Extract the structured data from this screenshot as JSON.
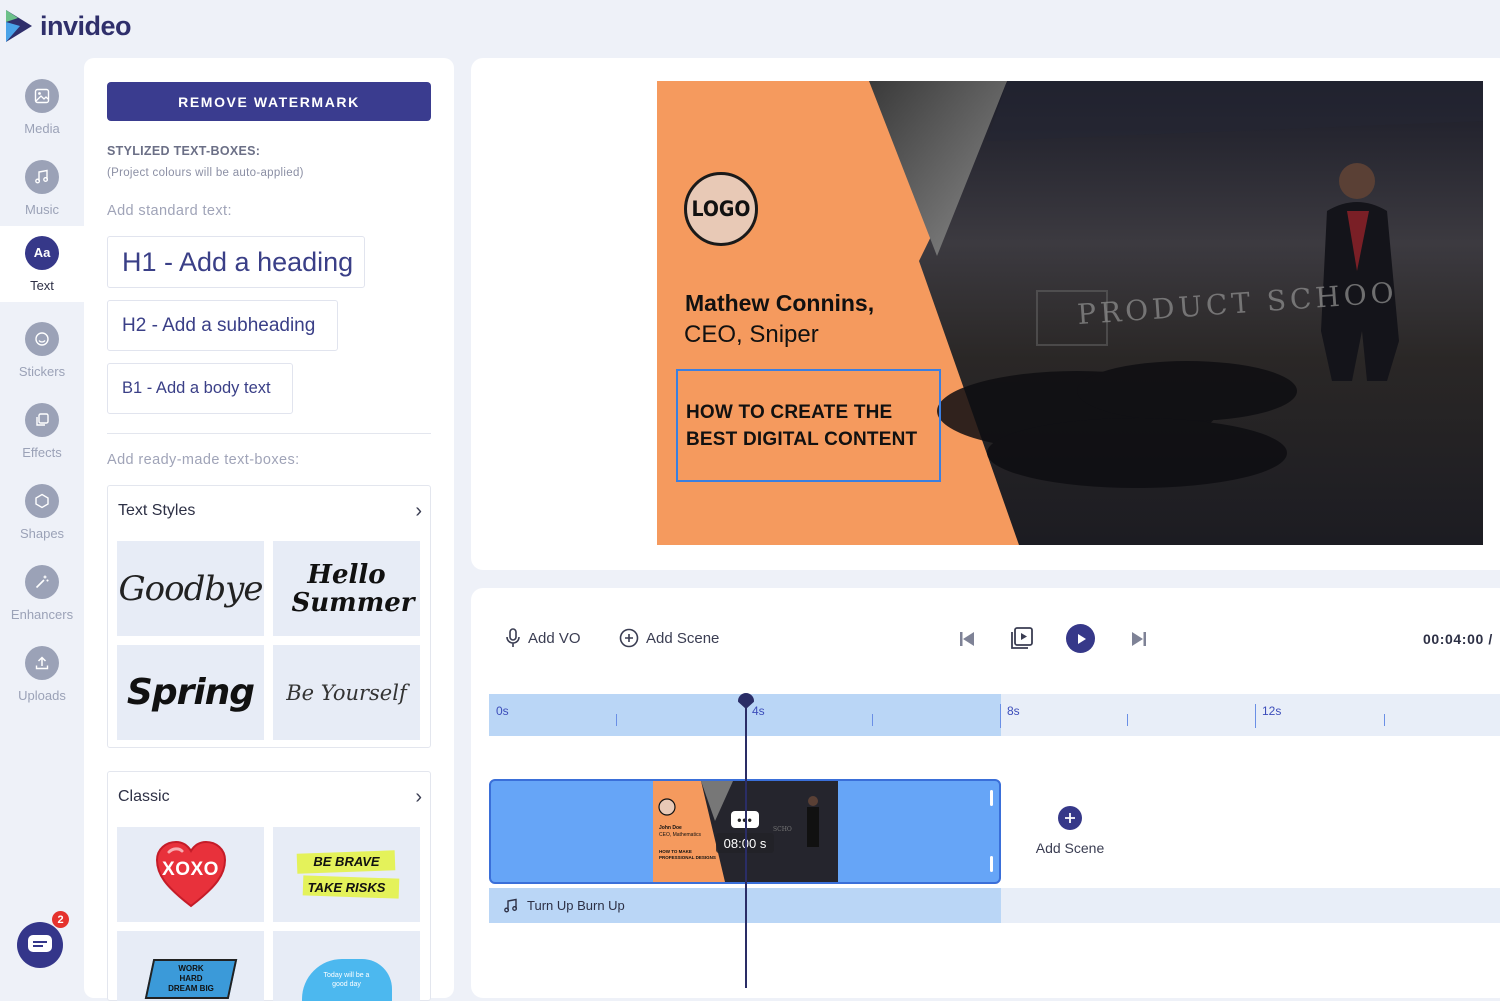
{
  "app": {
    "brand": "invideo",
    "colors": {
      "accent": "#3a3c8f",
      "orange": "#f59a5e",
      "timeline_blue": "#66a5f7",
      "badge_red": "#e5322d"
    }
  },
  "sidebar": {
    "items": [
      {
        "label": "Media",
        "icon": "image-icon"
      },
      {
        "label": "Music",
        "icon": "music-note-icon"
      },
      {
        "label": "Text",
        "icon_text": "Aa",
        "active": true
      },
      {
        "label": "Stickers",
        "icon": "smiley-icon"
      },
      {
        "label": "Effects",
        "icon": "layers-icon"
      },
      {
        "label": "Shapes",
        "icon": "hexagon-icon"
      },
      {
        "label": "Enhancers",
        "icon": "magic-wand-icon"
      },
      {
        "label": "Uploads",
        "icon": "upload-icon"
      }
    ],
    "chat_badge": "2"
  },
  "panel": {
    "remove_watermark": "REMOVE WATERMARK",
    "stylized_heading": "STYLIZED TEXT-BOXES:",
    "stylized_note": "(Project colours will be auto-applied)",
    "standard_label": "Add standard text:",
    "h1": "H1 - Add a heading",
    "h2": "H2 - Add a subheading",
    "b1": "B1 - Add a body text",
    "ready_made_label": "Add ready-made text-boxes:",
    "sections": [
      {
        "title": "Text Styles",
        "thumbs": [
          "Goodbye",
          "Hello Summer",
          "Spring",
          "Be Yourself"
        ]
      },
      {
        "title": "Classic",
        "thumbs": [
          "XOXO",
          "BE BRAVE TAKE RISKS",
          "WORK HARD DREAM BIG",
          "Today will be a good day"
        ]
      }
    ]
  },
  "canvas": {
    "logo": "LOGO",
    "name": "Mathew Connins,",
    "role": "CEO, Sniper",
    "headline": "HOW TO CREATE THE\nBEST DIGITAL CONTENT",
    "backdrop_text": "PRODUCT SCHOO"
  },
  "timeline": {
    "add_vo": "Add VO",
    "add_scene": "Add Scene",
    "time": "00:04:00 /",
    "ticks": [
      "0s",
      "4s",
      "8s",
      "12s"
    ],
    "clip_time": "08:00 s",
    "clip_more": "•••",
    "thumb_name": "John Doe",
    "thumb_role": "CEO, Mathematics",
    "thumb_headline": "HOW TO MAKE PROFESSIONAL DESIGNS",
    "audio_track": "Turn Up Burn Up",
    "add_scene_2": "Add Scene"
  }
}
